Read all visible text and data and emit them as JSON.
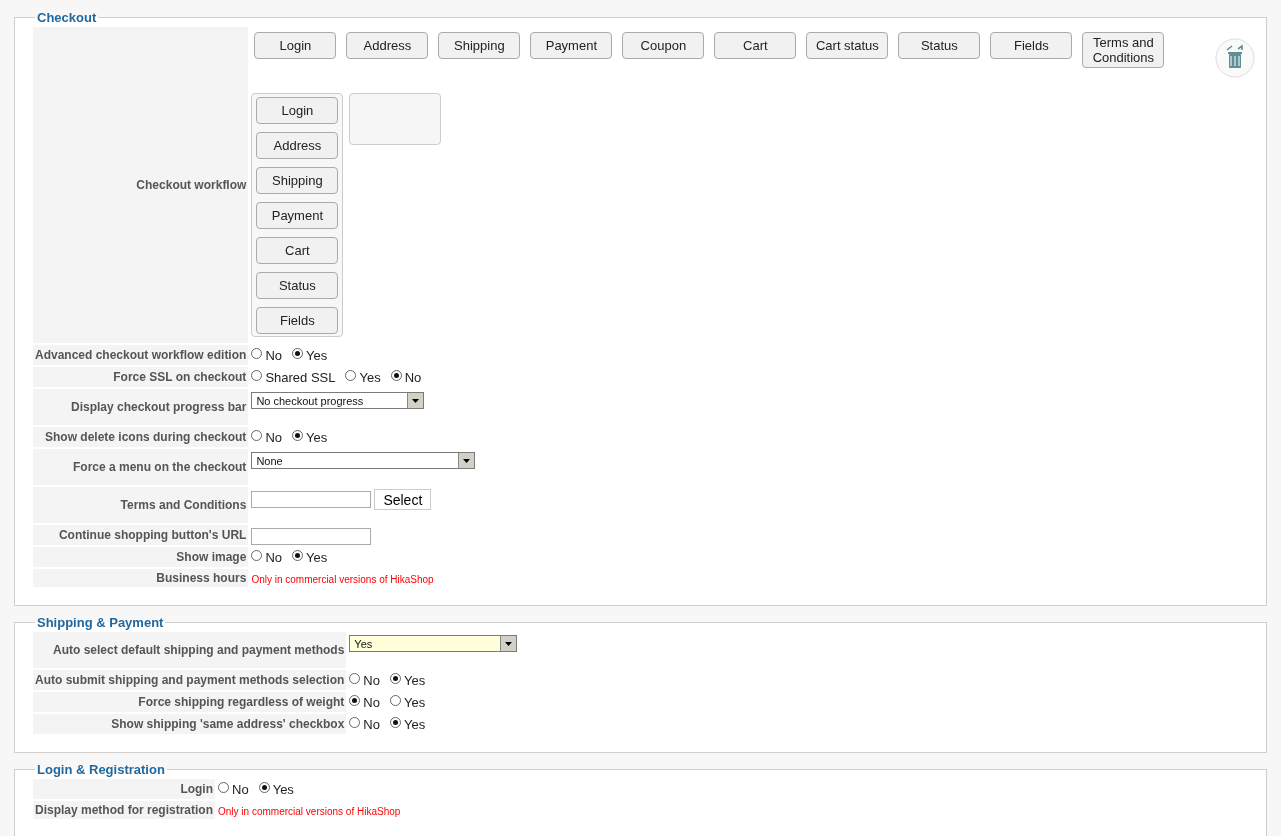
{
  "sections": [
    {
      "title": "Checkout",
      "rows": [
        {
          "kind": "workflow",
          "label": "Checkout workflow",
          "palette": [
            "Login",
            "Address",
            "Shipping",
            "Payment",
            "Coupon",
            "Cart",
            "Cart status",
            "Status",
            "Fields",
            "Terms and Conditions"
          ],
          "groups": [
            {
              "items": [
                "Login",
                "Address",
                "Shipping",
                "Payment",
                "Cart",
                "Status",
                "Fields"
              ]
            },
            {
              "empty": true
            }
          ]
        },
        {
          "kind": "radio",
          "label": "Advanced checkout workflow edition",
          "options": [
            {
              "label": "No",
              "selected": false
            },
            {
              "label": "Yes",
              "selected": true
            }
          ]
        },
        {
          "kind": "radio",
          "label": "Force SSL on checkout",
          "options": [
            {
              "label": "Shared SSL",
              "selected": false
            },
            {
              "label": "Yes",
              "selected": false
            },
            {
              "label": "No",
              "selected": true
            }
          ]
        },
        {
          "kind": "select",
          "label": "Display checkout progress bar",
          "value": "No checkout progress",
          "highlighted": false
        },
        {
          "kind": "radio",
          "label": "Show delete icons during checkout",
          "options": [
            {
              "label": "No",
              "selected": false
            },
            {
              "label": "Yes",
              "selected": true
            }
          ]
        },
        {
          "kind": "select",
          "label": "Force a menu on the checkout",
          "value": "None",
          "highlighted": false
        },
        {
          "kind": "picker",
          "label": "Terms and Conditions",
          "button": "Select"
        },
        {
          "kind": "input",
          "label": "Continue shopping button's URL"
        },
        {
          "kind": "radio",
          "label": "Show image",
          "options": [
            {
              "label": "No",
              "selected": false
            },
            {
              "label": "Yes",
              "selected": true
            }
          ]
        },
        {
          "kind": "notice",
          "label": "Business hours",
          "note": "Only in commercial versions of HikaShop"
        }
      ]
    },
    {
      "title": "Shipping & Payment",
      "rows": [
        {
          "kind": "select",
          "label": "Auto select default shipping and payment methods",
          "value": "Yes",
          "highlighted": true
        },
        {
          "kind": "radio",
          "label": "Auto submit shipping and payment methods selection",
          "options": [
            {
              "label": "No",
              "selected": false
            },
            {
              "label": "Yes",
              "selected": true
            }
          ]
        },
        {
          "kind": "radio",
          "label": "Force shipping regardless of weight",
          "options": [
            {
              "label": "No",
              "selected": true
            },
            {
              "label": "Yes",
              "selected": false
            }
          ]
        },
        {
          "kind": "radio",
          "label": "Show shipping 'same address' checkbox",
          "options": [
            {
              "label": "No",
              "selected": false
            },
            {
              "label": "Yes",
              "selected": true
            }
          ]
        }
      ]
    },
    {
      "title": "Login & Registration",
      "rows": [
        {
          "kind": "radio",
          "label": "Login",
          "options": [
            {
              "label": "No",
              "selected": false
            },
            {
              "label": "Yes",
              "selected": true
            }
          ]
        },
        {
          "kind": "notice",
          "label": "Display method for registration",
          "note": "Only in commercial versions of HikaShop"
        }
      ]
    }
  ]
}
